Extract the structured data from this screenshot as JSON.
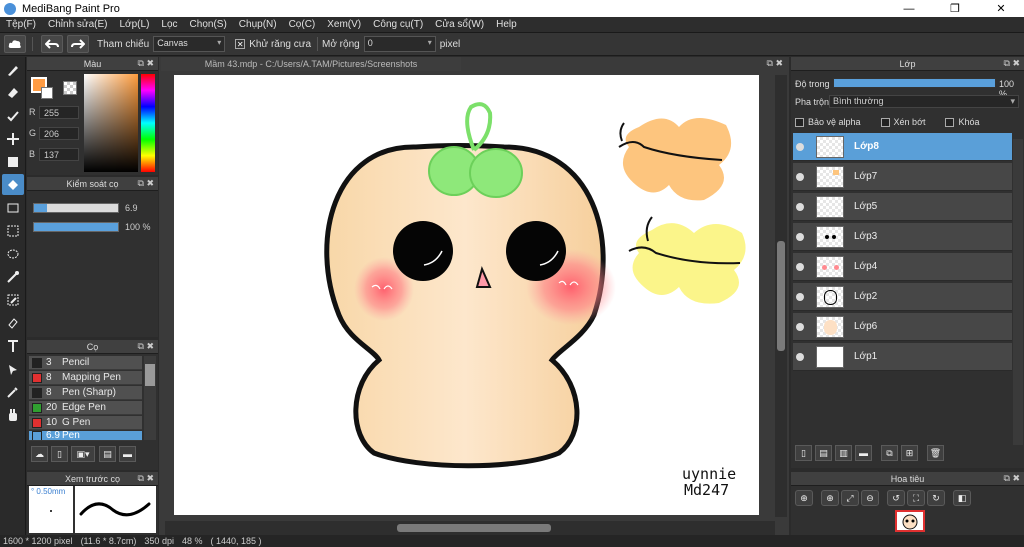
{
  "window": {
    "title": "MediBang Paint Pro",
    "minimize": "—",
    "maximize": "❐",
    "close": "✕"
  },
  "menu": [
    "Tệp(F)",
    "Chỉnh sửa(E)",
    "Lớp(L)",
    "Lọc",
    "Chọn(S)",
    "Chụp(N)",
    "Cọ(C)",
    "Xem(V)",
    "Công cụ(T)",
    "Cửa sổ(W)",
    "Help"
  ],
  "toolbar": {
    "reference_label": "Tham chiếu",
    "reference_value": "Canvas",
    "antialias_label": "Khử răng cưa",
    "antialias_checked": "✕",
    "expand_label": "Mở rộng",
    "expand_value": "0",
    "unit": "pixel"
  },
  "color_panel": {
    "title": "Màu",
    "primary_color": "#ff9c44",
    "r_label": "R",
    "r": "255",
    "g_label": "G",
    "g": "206",
    "b_label": "B",
    "b": "137"
  },
  "brush_control": {
    "title": "Kiểm soát cọ",
    "size": "6.9",
    "size_fraction": 0.16,
    "opacity": "100 %",
    "opacity_fraction": 1.0
  },
  "brush_panel": {
    "title": "Cọ",
    "items": [
      {
        "size": "3",
        "name": "Pencil",
        "color": "#222222"
      },
      {
        "size": "8",
        "name": "Mapping Pen",
        "color": "#e03030"
      },
      {
        "size": "8",
        "name": "Pen (Sharp)",
        "color": "#222222"
      },
      {
        "size": "20",
        "name": "Edge Pen",
        "color": "#30a030"
      },
      {
        "size": "10",
        "name": "G Pen",
        "color": "#e03030"
      },
      {
        "size": "6.9",
        "name": "Pen",
        "color": "#5a9fd8"
      }
    ]
  },
  "brush_preview": {
    "title": "Xem trước cọ",
    "size": "° 0.50mm"
  },
  "document": {
    "tab": "Mầm 43.mdp - C:/Users/A.TAM/Pictures/Screenshots",
    "signature_line1": "uynnie",
    "signature_line2": "Md247"
  },
  "layer_panel": {
    "title": "Lớp",
    "opacity_label": "Độ trong",
    "opacity_value": "100 %",
    "blend_label": "Pha trộn",
    "blend_value": "Bình thường",
    "protect_alpha": "Bảo vệ alpha",
    "clipping": "Xén bớt",
    "lock": "Khóa",
    "layers": [
      {
        "name": "Lớp8",
        "selected": true
      },
      {
        "name": "Lớp7",
        "selected": false
      },
      {
        "name": "Lớp5",
        "selected": false
      },
      {
        "name": "Lớp3",
        "selected": false
      },
      {
        "name": "Lớp4",
        "selected": false
      },
      {
        "name": "Lớp2",
        "selected": false
      },
      {
        "name": "Lớp6",
        "selected": false
      },
      {
        "name": "Lớp1",
        "selected": false
      }
    ]
  },
  "navigator": {
    "title": "Hoa tiêu"
  },
  "status": {
    "size": "1600 * 1200 pixel",
    "physical": "(11.6 * 8.7cm)",
    "dpi": "350 dpi",
    "zoom": "48 %",
    "coords": "( 1440, 185 )"
  }
}
